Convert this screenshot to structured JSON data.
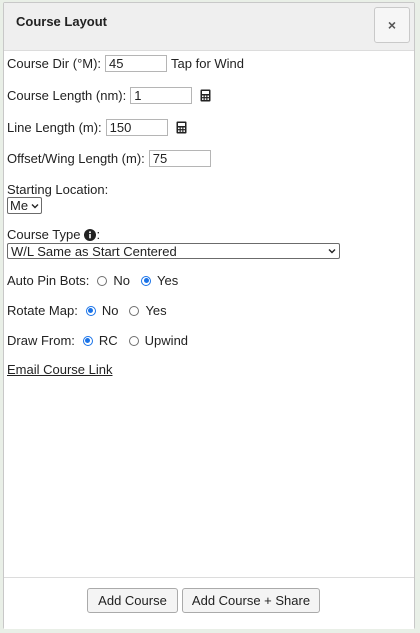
{
  "dialog": {
    "title": "Course Layout",
    "close_symbol": "×"
  },
  "form": {
    "course_dir": {
      "label": "Course Dir (°M):",
      "value": "45",
      "wind_link": "Tap for Wind"
    },
    "course_length": {
      "label": "Course Length (nm):",
      "value": "1",
      "icon": "calculator-icon"
    },
    "line_length": {
      "label": "Line Length (m):",
      "value": "150",
      "icon": "calculator-icon"
    },
    "offset_length": {
      "label": "Offset/Wing Length (m):",
      "value": "75"
    },
    "starting_location": {
      "label": "Starting Location:",
      "selected": "Me"
    },
    "course_type": {
      "label": "Course Type",
      "label_suffix": ":",
      "selected": "W/L Same as Start Centered",
      "icon": "info-icon"
    },
    "auto_pin_bots": {
      "label": "Auto Pin Bots:",
      "options": [
        "No",
        "Yes"
      ],
      "selected": "Yes"
    },
    "rotate_map": {
      "label": "Rotate Map:",
      "options": [
        "No",
        "Yes"
      ],
      "selected": "No"
    },
    "draw_from": {
      "label": "Draw From:",
      "options": [
        "RC",
        "Upwind"
      ],
      "selected": "RC"
    },
    "email_link": "Email Course Link"
  },
  "footer": {
    "add_course": "Add Course",
    "add_course_share": "Add Course + Share"
  },
  "colors": {
    "accent": "#1a73e8",
    "header_bg": "#efefef"
  }
}
